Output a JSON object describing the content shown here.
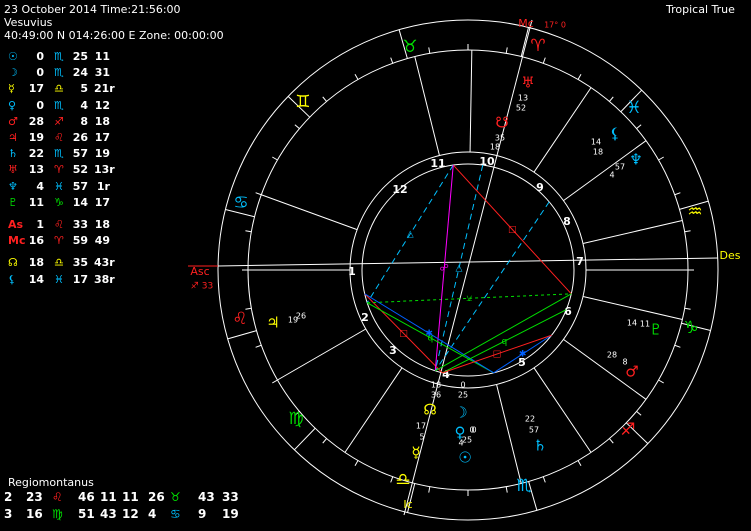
{
  "header": {
    "line1": "23 October 2014 Time:21:56:00",
    "line2": "Vesuvius",
    "line3": "40:49:00 N 014:26:00 E Zone: 00:00:00",
    "mode": "Tropical True"
  },
  "colors": {
    "background": "#000000",
    "wheel": "#ffffff",
    "fire": "#ff2020",
    "earth": "#00e000",
    "air": "#ffff00",
    "water": "#00c0ff",
    "magenta": "#ff00ff",
    "aspect_square": "#ff2020",
    "aspect_trine": "#00c0ff",
    "aspect_sextile": "#0060ff",
    "aspect_opposition": "#ff00ff",
    "aspect_quincunx": "#00e000",
    "aspect_semisextile": "#00e000",
    "aspect_conjunction": "#ffff00"
  },
  "planets": [
    {
      "glyph": "☉",
      "glyph_color": "#00c0ff",
      "deg": "0",
      "sign": "♏",
      "sign_color": "#00c0ff",
      "min": "25",
      "sec": "11"
    },
    {
      "glyph": "☽",
      "glyph_color": "#00c0ff",
      "deg": "0",
      "sign": "♏",
      "sign_color": "#00c0ff",
      "min": "24",
      "sec": "31"
    },
    {
      "glyph": "☿",
      "glyph_color": "#ffff00",
      "deg": "17",
      "sign": "♎",
      "sign_color": "#ffff00",
      "min": "5",
      "sec": "21r"
    },
    {
      "glyph": "♀",
      "glyph_color": "#00c0ff",
      "deg": "0",
      "sign": "♏",
      "sign_color": "#00c0ff",
      "min": "4",
      "sec": "12"
    },
    {
      "glyph": "♂",
      "glyph_color": "#ff2020",
      "deg": "28",
      "sign": "♐",
      "sign_color": "#ff2020",
      "min": "8",
      "sec": "18"
    },
    {
      "glyph": "♃",
      "glyph_color": "#ff2020",
      "deg": "19",
      "sign": "♌",
      "sign_color": "#ff2020",
      "min": "26",
      "sec": "17"
    },
    {
      "glyph": "♄",
      "glyph_color": "#00c0ff",
      "deg": "22",
      "sign": "♏",
      "sign_color": "#00c0ff",
      "min": "57",
      "sec": "19"
    },
    {
      "glyph": "♅",
      "glyph_color": "#ff2020",
      "deg": "13",
      "sign": "♈",
      "sign_color": "#ff2020",
      "min": "52",
      "sec": "13r"
    },
    {
      "glyph": "♆",
      "glyph_color": "#00c0ff",
      "deg": "4",
      "sign": "♓",
      "sign_color": "#00c0ff",
      "min": "57",
      "sec": "1r"
    },
    {
      "glyph": "♇",
      "glyph_color": "#00e000",
      "deg": "11",
      "sign": "♑",
      "sign_color": "#00e000",
      "min": "14",
      "sec": "17"
    }
  ],
  "angles": [
    {
      "glyph": "As",
      "glyph_color": "#ff2020",
      "deg": "1",
      "sign": "♌",
      "sign_color": "#ff2020",
      "min": "33",
      "sec": "18"
    },
    {
      "glyph": "Mc",
      "glyph_color": "#ff2020",
      "deg": "16",
      "sign": "♈",
      "sign_color": "#ff2020",
      "min": "59",
      "sec": "49"
    }
  ],
  "nodes": [
    {
      "glyph": "☊",
      "glyph_color": "#ffff00",
      "deg": "18",
      "sign": "♎",
      "sign_color": "#ffff00",
      "min": "35",
      "sec": "43r"
    },
    {
      "glyph": "⚸",
      "glyph_color": "#00c0ff",
      "deg": "14",
      "sign": "♓",
      "sign_color": "#00c0ff",
      "min": "17",
      "sec": "38r"
    }
  ],
  "house_system": {
    "title": "Regiomontanus",
    "rows": [
      [
        {
          "text": "2",
          "color": "#ffffff"
        },
        {
          "text": "23",
          "color": "#ffffff"
        },
        {
          "text": "♌",
          "color": "#ff2020"
        },
        {
          "text": "46",
          "color": "#ffffff"
        },
        {
          "text": "11",
          "color": "#ffffff"
        },
        {
          "text": "11",
          "color": "#ffffff"
        },
        {
          "text": "26",
          "color": "#ffffff"
        },
        {
          "text": "♉",
          "color": "#00e000"
        },
        {
          "text": "43",
          "color": "#ffffff"
        },
        {
          "text": "33",
          "color": "#ffffff"
        }
      ],
      [
        {
          "text": "3",
          "color": "#ffffff"
        },
        {
          "text": "16",
          "color": "#ffffff"
        },
        {
          "text": "♍",
          "color": "#00e000"
        },
        {
          "text": "51",
          "color": "#ffffff"
        },
        {
          "text": "43",
          "color": "#ffffff"
        },
        {
          "text": "12",
          "color": "#ffffff"
        },
        {
          "text": "4",
          "color": "#ffffff"
        },
        {
          "text": "♋",
          "color": "#00c0ff"
        },
        {
          "text": "9",
          "color": "#ffffff"
        },
        {
          "text": "19",
          "color": "#ffffff"
        }
      ]
    ]
  },
  "chart": {
    "angle_labels": {
      "asc": "Asc",
      "asc_pos": "♐ 33",
      "mc": "Mc",
      "mc_pos": "17° 0",
      "des": "Des",
      "ic": "Ic"
    },
    "house_numbers": [
      "1",
      "2",
      "3",
      "4",
      "5",
      "6",
      "7",
      "8",
      "9",
      "10",
      "11",
      "12"
    ],
    "sign_ring": [
      "♈",
      "♉",
      "♊",
      "♋",
      "♌",
      "♍",
      "♎",
      "♏",
      "♐",
      "♑",
      "♒",
      "♓"
    ],
    "planet_labels": [
      {
        "glyph": "♅",
        "color": "#ff2020",
        "degree": "13",
        "minute": "52"
      },
      {
        "glyph": "☋",
        "color": "#ff2020",
        "degree": "18",
        "minute": "35"
      },
      {
        "glyph": "⚸",
        "color": "#00c0ff",
        "degree": "18",
        "minute": "14"
      },
      {
        "glyph": "♆",
        "color": "#00c0ff",
        "degree": "4",
        "minute": "57"
      },
      {
        "glyph": "♃",
        "color": "#ffff00",
        "degree": "19",
        "minute": "26"
      },
      {
        "glyph": "♇",
        "color": "#00e000",
        "degree": "14",
        "minute": "11"
      },
      {
        "glyph": "♂",
        "color": "#ff2020",
        "degree": "28",
        "minute": "8"
      },
      {
        "glyph": "☿",
        "color": "#ffff00",
        "degree": "17",
        "minute": "5"
      },
      {
        "glyph": "☊",
        "color": "#ffff00",
        "degree": "18",
        "minute": "36"
      },
      {
        "glyph": "☽",
        "color": "#00c0ff",
        "degree": "0",
        "minute": "25"
      },
      {
        "glyph": "♀",
        "color": "#00c0ff",
        "degree": "0",
        "minute": "4"
      },
      {
        "glyph": "☉",
        "color": "#00c0ff",
        "degree": "0",
        "minute": "25"
      },
      {
        "glyph": "♄",
        "color": "#00c0ff",
        "degree": "22",
        "minute": "57"
      }
    ]
  }
}
